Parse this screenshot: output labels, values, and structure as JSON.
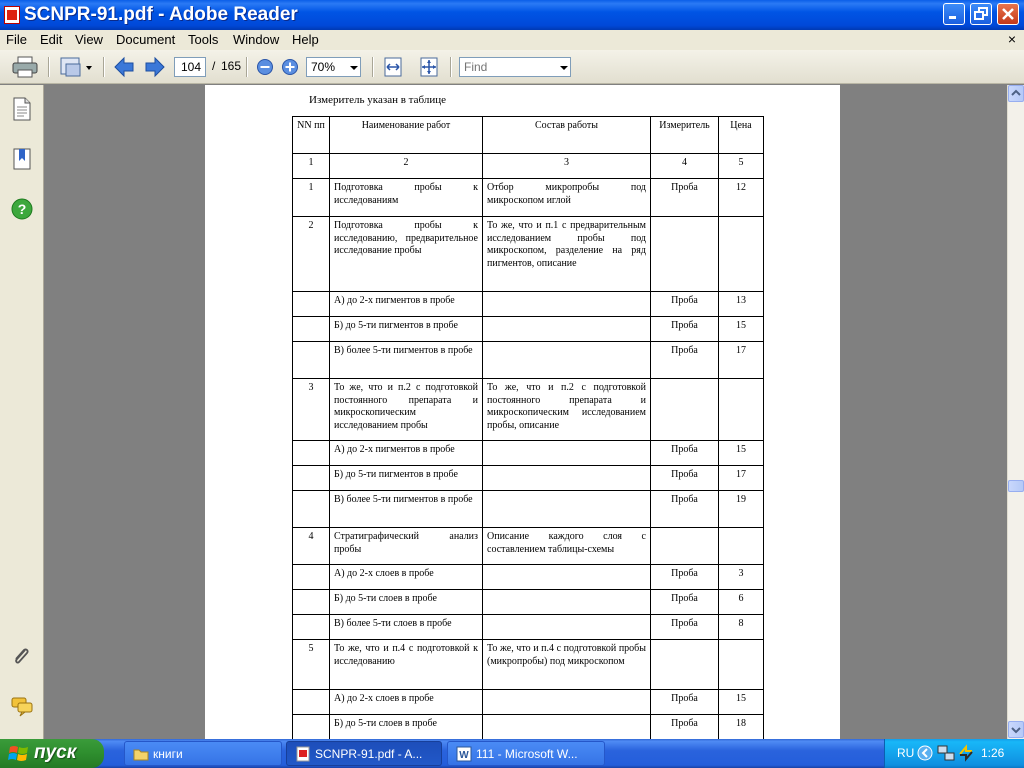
{
  "window": {
    "title": "SCNPR-91.pdf - Adobe Reader"
  },
  "menu": [
    "File",
    "Edit",
    "View",
    "Document",
    "Tools",
    "Window",
    "Help"
  ],
  "menu_close_glyph": "×",
  "toolbar": {
    "page_current": "104",
    "page_sep": "/",
    "page_total": "165",
    "zoom": "70%",
    "find_placeholder": "Find"
  },
  "document": {
    "caption": "Измеритель указан в таблице",
    "headers": [
      "NN пп",
      "Наименование работ",
      "Состав работы",
      "Измеритель",
      "Цена"
    ],
    "col_numbers": [
      "1",
      "2",
      "3",
      "4",
      "5"
    ],
    "rows": [
      [
        "1",
        "Подготовка пробы к исследованиям",
        "Отбор микропробы под микроскопом иглой",
        "Проба",
        "12"
      ],
      [
        "2",
        "Подготовка пробы к исследованию, предварительное исследование пробы",
        "То же, что и п.1 с предварительным исследованием пробы под микроскопом, разделение на ряд пигментов, описание",
        "",
        ""
      ],
      [
        "",
        "А) до 2-х пигментов в пробе",
        "",
        "Проба",
        "13"
      ],
      [
        "",
        "Б) до 5-ти пигментов в пробе",
        "",
        "Проба",
        "15"
      ],
      [
        "",
        "В) более 5-ти пигментов в пробе",
        "",
        "Проба",
        "17"
      ],
      [
        "3",
        "То же, что и п.2 с подготовкой постоянного препарата и микроскопическим исследованием пробы",
        "То же, что и п.2 с подготовкой постоянного препарата и микроскопическим исследованием пробы, описание",
        "",
        ""
      ],
      [
        "",
        "А) до 2-х пигментов в пробе",
        "",
        "Проба",
        "15"
      ],
      [
        "",
        "Б) до 5-ти пигментов в пробе",
        "",
        "Проба",
        "17"
      ],
      [
        "",
        "В) более 5-ти пигментов в пробе",
        "",
        "Проба",
        "19"
      ],
      [
        "4",
        "Стратиграфический анализ пробы",
        "Описание каждого слоя с составлением таблицы-схемы",
        "",
        ""
      ],
      [
        "",
        "А) до 2-х слоев в пробе",
        "",
        "Проба",
        "3"
      ],
      [
        "",
        "Б) до 5-ти слоев в пробе",
        "",
        "Проба",
        "6"
      ],
      [
        "",
        "В) более 5-ти слоев в пробе",
        "",
        "Проба",
        "8"
      ],
      [
        "5",
        "То же, что и п.4 с подготовкой к исследованию",
        "То же, что и п.4 с подготовкой пробы (микропробы) под микроскопом",
        "",
        ""
      ],
      [
        "",
        "А) до 2-х слоев в пробе",
        "",
        "Проба",
        "15"
      ],
      [
        "",
        "Б) до 5-ти слоев в пробе",
        "",
        "Проба",
        "18"
      ]
    ]
  },
  "taskbar": {
    "start": "пуск",
    "tasks": [
      {
        "label": "книги"
      },
      {
        "label": "SCNPR-91.pdf - A..."
      },
      {
        "label": "111 - Microsoft W..."
      }
    ],
    "lang": "RU",
    "clock": "1:26"
  },
  "colors": {
    "title_bar": "#0055e5",
    "taskbar": "#245edb",
    "start": "#2e8e2e",
    "chrome": "#ece9d8"
  }
}
